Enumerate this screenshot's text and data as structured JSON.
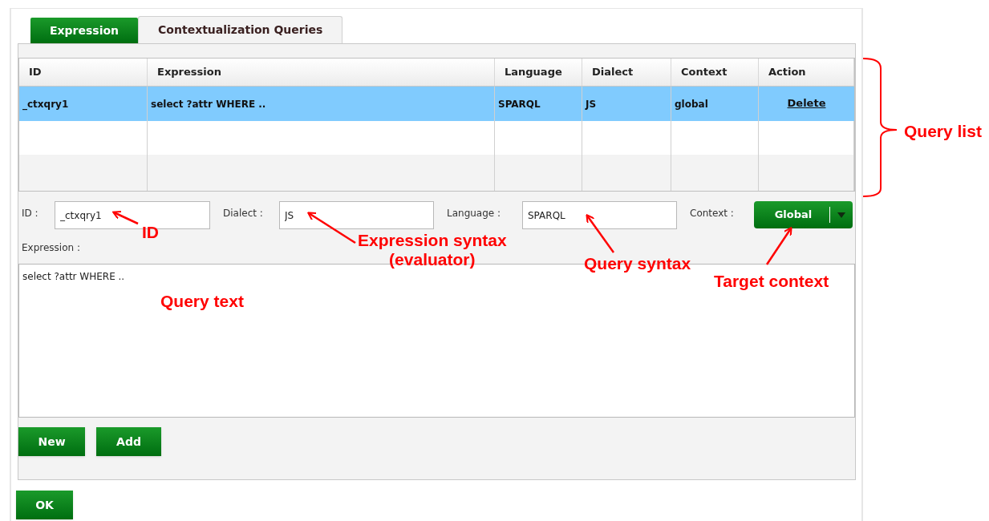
{
  "tabs": [
    {
      "label": "Expression",
      "selected": false
    },
    {
      "label": "Contextualization Queries",
      "selected": true
    }
  ],
  "table": {
    "columns": [
      "ID",
      "Expression",
      "Language",
      "Dialect",
      "Context",
      "Action"
    ],
    "rows": [
      {
        "cells": [
          "_ctxqry1",
          "select ?attr WHERE ..",
          "SPARQL",
          "JS",
          "global"
        ],
        "action": "Delete",
        "selected": true
      }
    ]
  },
  "form": {
    "fields": [
      {
        "label": "ID :",
        "value": "_ctxqry1"
      },
      {
        "label": "Dialect :",
        "value": "JS"
      },
      {
        "label": "Language :",
        "value": "SPARQL"
      }
    ],
    "context": {
      "label": "Context :",
      "value": "Global"
    },
    "expression": {
      "label": "Expression :",
      "value": "select ?attr WHERE .."
    }
  },
  "buttons": [
    "New",
    "Add"
  ],
  "ok_button": "OK",
  "annotations": [
    {
      "text": "Query list"
    },
    {
      "text": "ID"
    },
    {
      "text": "Expression syntax\n(evaluator)"
    },
    {
      "text": "Query syntax"
    },
    {
      "text": "Target context"
    },
    {
      "text": "Query text"
    }
  ]
}
